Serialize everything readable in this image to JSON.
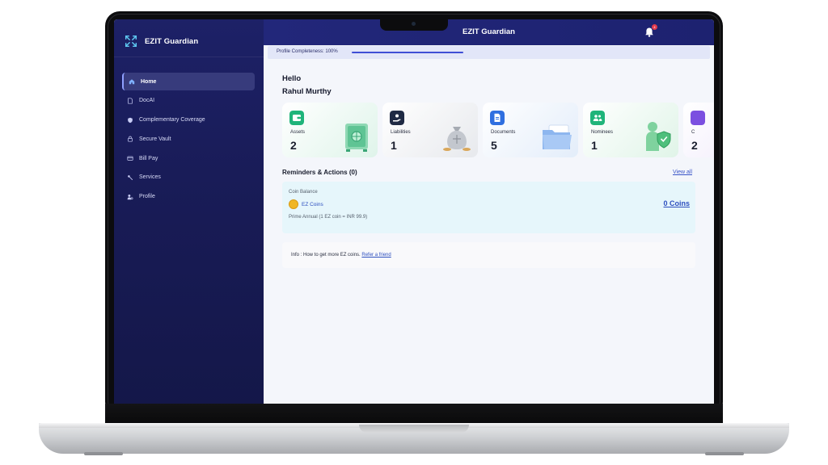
{
  "app": {
    "brand_name": "EZIT Guardian",
    "header_title": "EZIT Guardian",
    "notification_count": "4"
  },
  "sidebar": {
    "items": [
      {
        "label": "Home",
        "icon": "home-icon",
        "active": true
      },
      {
        "label": "DocAI",
        "icon": "document-icon",
        "active": false
      },
      {
        "label": "Complementary Coverage",
        "icon": "shield-icon",
        "active": false
      },
      {
        "label": "Secure Vault",
        "icon": "lock-icon",
        "active": false
      },
      {
        "label": "Bill Pay",
        "icon": "card-icon",
        "active": false
      },
      {
        "label": "Services",
        "icon": "tools-icon",
        "active": false
      },
      {
        "label": "Profile",
        "icon": "user-icon",
        "active": false
      }
    ]
  },
  "profile_progress": {
    "label": "Profile Completeness: 100%",
    "percent": 100
  },
  "greeting": {
    "hello": "Hello",
    "name": "Rahul Murthy"
  },
  "cards": [
    {
      "label": "Assets",
      "value": "2",
      "icon": "wallet-icon",
      "accent": "#1fb47a",
      "bg": "#dff4ea"
    },
    {
      "label": "Liabilities",
      "value": "1",
      "icon": "hand-coin-icon",
      "accent": "#1f2a44",
      "bg": "#eceef1"
    },
    {
      "label": "Documents",
      "value": "5",
      "icon": "document-icon",
      "accent": "#2f6fe0",
      "bg": "#e4eefb"
    },
    {
      "label": "Nominees",
      "value": "1",
      "icon": "people-icon",
      "accent": "#1fb47a",
      "bg": "#e2f5ea"
    },
    {
      "label": "C",
      "value": "2",
      "icon": "partial-icon",
      "accent": "#7b4fe0",
      "bg": "#efe9fb"
    }
  ],
  "reminders": {
    "title": "Reminders & Actions (0)",
    "view_all": "View all"
  },
  "coin_balance": {
    "title": "Coin Balance",
    "coin_name": "EZ Coins",
    "plan": "Prime Annual (1 EZ coin = INR 99.9)",
    "count": "0 Coins"
  },
  "info": {
    "text": "Info : How to get more EZ coins.",
    "link": "Refer a friend"
  },
  "colors": {
    "sidebar": "#1d2167",
    "accent": "#3f4fd6",
    "link": "#2d4fbf"
  }
}
